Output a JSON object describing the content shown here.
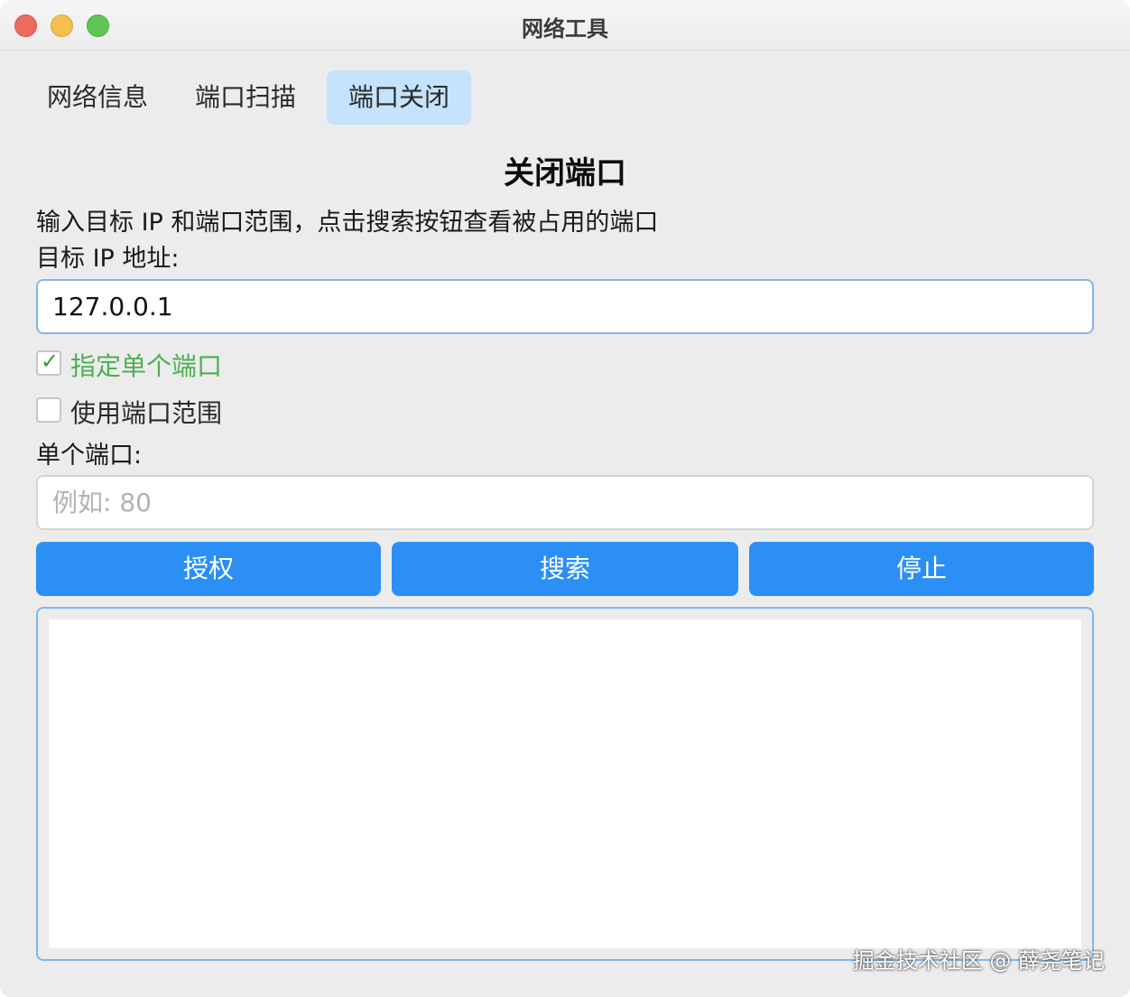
{
  "window": {
    "title": "网络工具"
  },
  "tabs": [
    {
      "label": "网络信息",
      "selected": false
    },
    {
      "label": "端口扫描",
      "selected": false
    },
    {
      "label": "端口关闭",
      "selected": true
    }
  ],
  "main": {
    "heading": "关闭端口",
    "description": "输入目标 IP 和端口范围，点击搜索按钮查看被占用的端口",
    "ip_label": "目标 IP 地址:",
    "ip_value": "127.0.0.1",
    "single_port_checkbox": {
      "label": "指定单个端口",
      "checked": true,
      "mark": "✓"
    },
    "port_range_checkbox": {
      "label": "使用端口范围",
      "checked": false
    },
    "port_label": "单个端口:",
    "port_value": "",
    "port_placeholder": "例如: 80"
  },
  "buttons": {
    "authorize": "授权",
    "search": "搜索",
    "stop": "停止"
  },
  "output": {
    "text": ""
  },
  "watermark": "掘金技术社区 @ 薛尧笔记",
  "colors": {
    "accent": "#2b8ff5",
    "tab_selected": "#c5e3fc",
    "checked_text": "#4caf50",
    "focus_border": "#7fb7ea"
  }
}
